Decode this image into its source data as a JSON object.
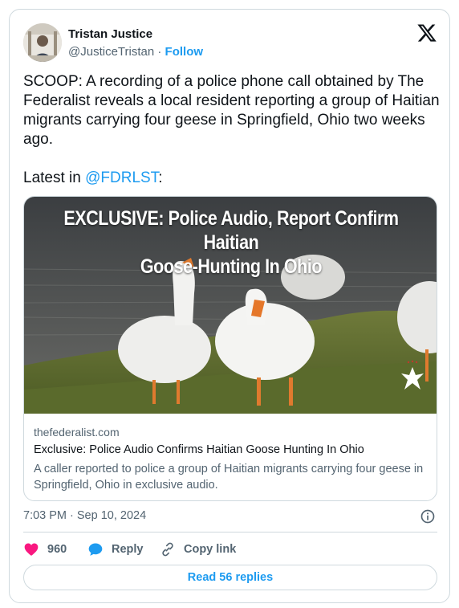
{
  "author": {
    "name": "Tristan Justice",
    "handle": "@JusticeTristan",
    "separator": " · ",
    "follow_label": "Follow"
  },
  "tweet": {
    "paragraph1": "SCOOP: A recording of a police phone call obtained by The Federalist reveals a local resident reporting a group of Haitian migrants carrying four geese in Springfield, Ohio two weeks ago.",
    "latest_prefix": "Latest in ",
    "mention": "@FDRLST",
    "latest_suffix": ":"
  },
  "link_card": {
    "image_headline_line1": "EXCLUSIVE: Police Audio, Report Confirm Haitian",
    "image_headline_line2": "Goose-Hunting In Ohio",
    "domain": "thefederalist.com",
    "title": "Exclusive: Police Audio Confirms Haitian Goose Hunting In Ohio",
    "description": "A caller reported to police a group of Haitian migrants carrying four geese in Springfield, Ohio in exclusive audio."
  },
  "meta": {
    "timestamp": "7:03 PM · Sep 10, 2024"
  },
  "actions": {
    "like_count": "960",
    "reply_label": "Reply",
    "copy_link_label": "Copy link",
    "read_replies_label": "Read 56 replies"
  },
  "icons": {
    "logo": "x-logo-icon",
    "info": "info-icon",
    "like": "heart-icon",
    "reply": "speech-bubble-icon",
    "copy": "link-icon"
  },
  "colors": {
    "accent": "#1d9bf0",
    "like": "#f91880",
    "text": "#0f1419",
    "secondary": "#536471",
    "border": "#cfd9de"
  }
}
